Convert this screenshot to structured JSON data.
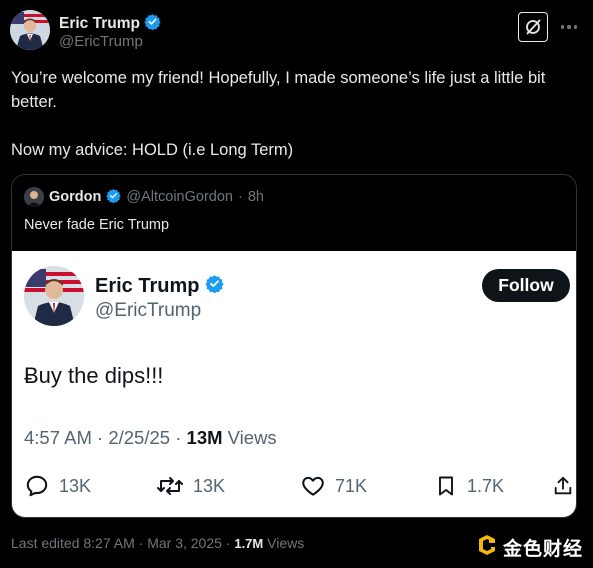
{
  "author": {
    "name": "Eric Trump",
    "handle": "@EricTrump",
    "verified": true
  },
  "tweet": {
    "line1": "You’re welcome my friend! Hopefully, I made someone’s life just a little bit better.",
    "line2": "Now my advice: HOLD (i.e Long Term)"
  },
  "quote": {
    "name": "Gordon",
    "handle": "@AltcoinGordon",
    "separator": "·",
    "age": "8h",
    "text": "Never fade Eric Trump",
    "embedded": {
      "name": "Eric Trump",
      "handle": "@EricTrump",
      "follow_label": "Follow",
      "text": "Ƀuy the dips!!!",
      "time": "4:57 AM",
      "date": "2/25/25",
      "views_count": "13M",
      "views_label": "Views",
      "metrics": {
        "replies": "13K",
        "reposts": "13K",
        "likes": "71K",
        "bookmarks": "1.7K"
      }
    }
  },
  "footer": {
    "edited": "Last edited 8:27 AM · Mar 3, 2025 · ",
    "views_count": "1.7M",
    "views_label": "Views"
  },
  "watermark": {
    "text": "金色财经"
  },
  "colors": {
    "verified": "#1d9bf0",
    "background": "#000000",
    "muted": "#71767b"
  }
}
